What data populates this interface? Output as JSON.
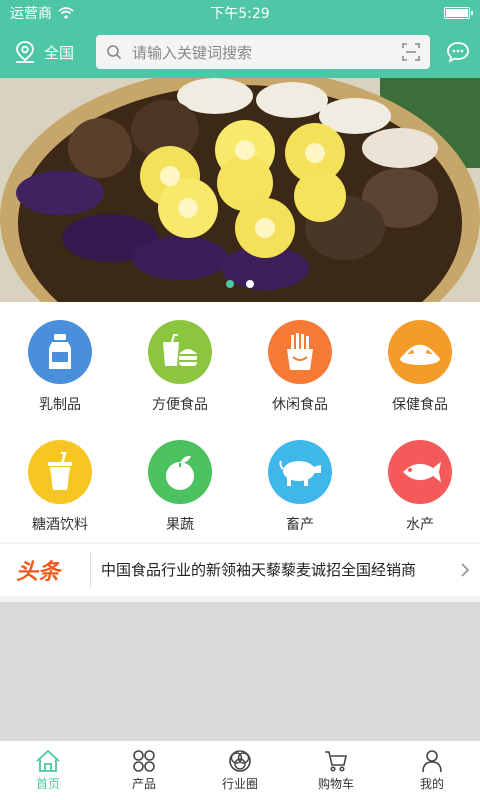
{
  "status_bar": {
    "carrier": "运营商",
    "time": "下午5:29"
  },
  "header": {
    "location": "全国",
    "search_placeholder": "请输入关键词搜索"
  },
  "banner": {
    "slide_count": 2,
    "active_slide": 1
  },
  "categories": [
    {
      "label": "乳制品",
      "color": "#4a8fdc",
      "icon": "milk-bottle-icon"
    },
    {
      "label": "方便食品",
      "color": "#8cc63f",
      "icon": "fast-food-icon"
    },
    {
      "label": "休闲食品",
      "color": "#f47a36",
      "icon": "fries-icon"
    },
    {
      "label": "保健食品",
      "color": "#f39c2a",
      "icon": "health-food-icon"
    },
    {
      "label": "糖酒饮料",
      "color": "#f6c623",
      "icon": "drink-icon"
    },
    {
      "label": "果蔬",
      "color": "#4cc15f",
      "icon": "fruit-icon"
    },
    {
      "label": "畜产",
      "color": "#3fb7e8",
      "icon": "livestock-icon"
    },
    {
      "label": "水产",
      "color": "#f55a5a",
      "icon": "fish-icon"
    }
  ],
  "news": {
    "tag": "头条",
    "headline": "中国食品行业的新领袖天藜藜麦诚招全国经销商"
  },
  "tabs": [
    {
      "label": "首页",
      "icon": "home-icon",
      "active": true
    },
    {
      "label": "产品",
      "icon": "grid-icon",
      "active": false
    },
    {
      "label": "行业圈",
      "icon": "circles-icon",
      "active": false
    },
    {
      "label": "购物车",
      "icon": "cart-icon",
      "active": false
    },
    {
      "label": "我的",
      "icon": "user-icon",
      "active": false
    }
  ],
  "colors": {
    "primary": "#4fc7a6",
    "headline_tag": "#f05a1e"
  }
}
